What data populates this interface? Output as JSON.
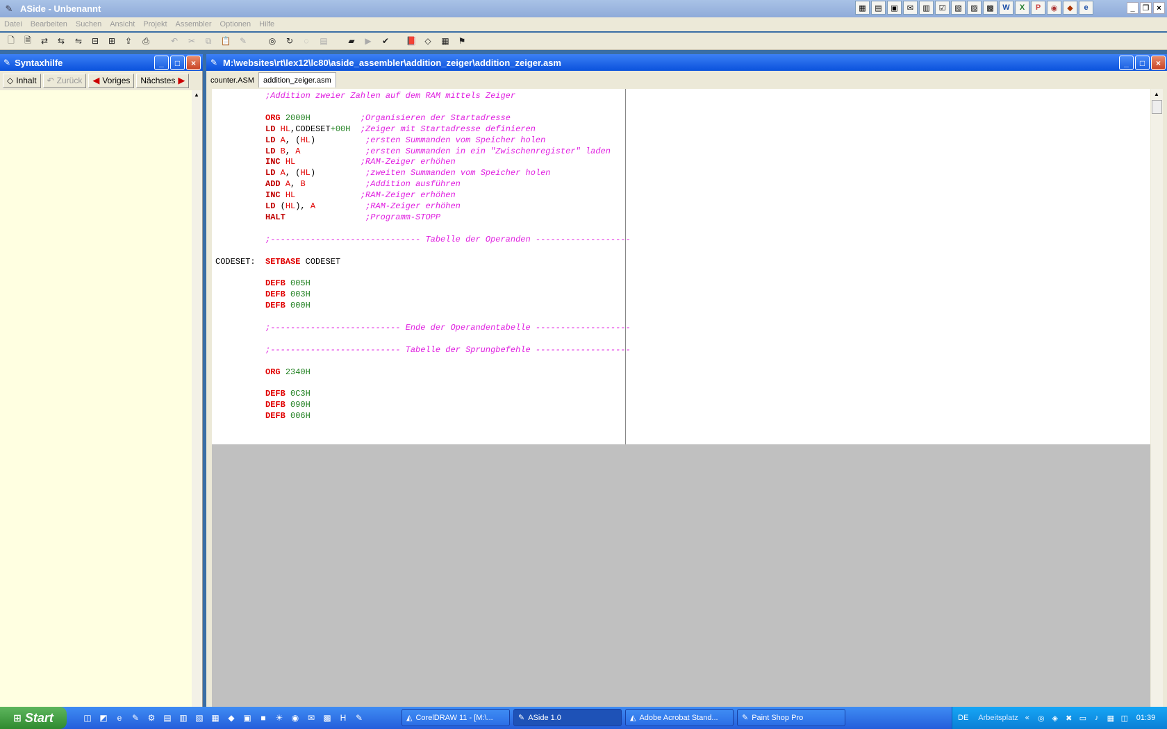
{
  "window": {
    "title": "ASide - Unbenannt"
  },
  "menu": [
    "Datei",
    "Bearbeiten",
    "Suchen",
    "Ansicht",
    "Projekt",
    "Assembler",
    "Optionen",
    "Hilfe"
  ],
  "syntax_panel": {
    "title": "Syntaxhilfe",
    "nav": {
      "contents": "Inhalt",
      "back": "Zurück",
      "prev": "Voriges",
      "next": "Nächstes"
    }
  },
  "editor": {
    "title": "M:\\websites\\rt\\lex12\\lc80\\aside_assembler\\addition_zeiger\\addition_zeiger.asm",
    "tabs": [
      "counter.ASM",
      "addition_zeiger.asm"
    ],
    "active_tab": 1,
    "code": [
      {
        "line": 0,
        "parts": [
          {
            "t": "          "
          },
          {
            "c": "cm",
            "t": ";Addition zweier Zahlen auf dem RAM mittels Zeiger"
          }
        ]
      },
      {
        "line": 2,
        "parts": [
          {
            "t": "          "
          },
          {
            "c": "kwr",
            "t": "ORG"
          },
          {
            "t": " "
          },
          {
            "c": "num",
            "t": "2000H"
          },
          {
            "t": "          "
          },
          {
            "c": "cm",
            "t": ";Organisieren der Startadresse"
          }
        ]
      },
      {
        "line": 3,
        "parts": [
          {
            "t": "          "
          },
          {
            "c": "kw",
            "t": "LD"
          },
          {
            "t": " "
          },
          {
            "c": "reg",
            "t": "HL"
          },
          {
            "t": ",CODESET"
          },
          {
            "c": "num",
            "t": "+00H"
          },
          {
            "t": "  "
          },
          {
            "c": "cm",
            "t": ";Zeiger mit Startadresse definieren"
          }
        ]
      },
      {
        "line": 4,
        "parts": [
          {
            "t": "          "
          },
          {
            "c": "kw",
            "t": "LD"
          },
          {
            "t": " "
          },
          {
            "c": "reg",
            "t": "A"
          },
          {
            "t": ", ("
          },
          {
            "c": "reg",
            "t": "HL"
          },
          {
            "t": ")"
          },
          {
            "t": "          "
          },
          {
            "c": "cm",
            "t": ";ersten Summanden vom Speicher holen"
          }
        ]
      },
      {
        "line": 5,
        "parts": [
          {
            "t": "          "
          },
          {
            "c": "kw",
            "t": "LD"
          },
          {
            "t": " "
          },
          {
            "c": "reg",
            "t": "B"
          },
          {
            "t": ", "
          },
          {
            "c": "reg",
            "t": "A"
          },
          {
            "t": "             "
          },
          {
            "c": "cm",
            "t": ";ersten Summanden in ein \"Zwischenregister\" laden"
          }
        ]
      },
      {
        "line": 6,
        "parts": [
          {
            "t": "          "
          },
          {
            "c": "kw",
            "t": "INC"
          },
          {
            "t": " "
          },
          {
            "c": "reg",
            "t": "HL"
          },
          {
            "t": "             "
          },
          {
            "c": "cm",
            "t": ";RAM-Zeiger erhöhen"
          }
        ]
      },
      {
        "line": 7,
        "parts": [
          {
            "t": "          "
          },
          {
            "c": "kw",
            "t": "LD"
          },
          {
            "t": " "
          },
          {
            "c": "reg",
            "t": "A"
          },
          {
            "t": ", ("
          },
          {
            "c": "reg",
            "t": "HL"
          },
          {
            "t": ")"
          },
          {
            "t": "          "
          },
          {
            "c": "cm",
            "t": ";zweiten Summanden vom Speicher holen"
          }
        ]
      },
      {
        "line": 8,
        "parts": [
          {
            "t": "          "
          },
          {
            "c": "kw",
            "t": "ADD"
          },
          {
            "t": " "
          },
          {
            "c": "reg",
            "t": "A"
          },
          {
            "t": ", "
          },
          {
            "c": "reg",
            "t": "B"
          },
          {
            "t": "            "
          },
          {
            "c": "cm",
            "t": ";Addition ausführen"
          }
        ]
      },
      {
        "line": 9,
        "parts": [
          {
            "t": "          "
          },
          {
            "c": "kw",
            "t": "INC"
          },
          {
            "t": " "
          },
          {
            "c": "reg",
            "t": "HL"
          },
          {
            "t": "             "
          },
          {
            "c": "cm",
            "t": ";RAM-Zeiger erhöhen"
          }
        ]
      },
      {
        "line": 10,
        "parts": [
          {
            "t": "          "
          },
          {
            "c": "kw",
            "t": "LD"
          },
          {
            "t": " ("
          },
          {
            "c": "reg",
            "t": "HL"
          },
          {
            "t": "), "
          },
          {
            "c": "reg",
            "t": "A"
          },
          {
            "t": "          "
          },
          {
            "c": "cm",
            "t": ";RAM-Zeiger erhöhen"
          }
        ]
      },
      {
        "line": 11,
        "parts": [
          {
            "t": "          "
          },
          {
            "c": "kw",
            "t": "HALT"
          },
          {
            "t": "                "
          },
          {
            "c": "cm",
            "t": ";Programm-STOPP"
          }
        ]
      },
      {
        "line": 13,
        "parts": [
          {
            "t": "          "
          },
          {
            "c": "cm",
            "t": ";------------------------------ Tabelle der Operanden -------------------"
          }
        ]
      },
      {
        "line": 15,
        "parts": [
          {
            "t": "CODESET:  "
          },
          {
            "c": "kwr",
            "t": "SETBASE"
          },
          {
            "t": " CODESET"
          }
        ]
      },
      {
        "line": 17,
        "parts": [
          {
            "t": "          "
          },
          {
            "c": "kwr",
            "t": "DEFB"
          },
          {
            "t": " "
          },
          {
            "c": "num",
            "t": "005H"
          }
        ]
      },
      {
        "line": 18,
        "parts": [
          {
            "t": "          "
          },
          {
            "c": "kwr",
            "t": "DEFB"
          },
          {
            "t": " "
          },
          {
            "c": "num",
            "t": "003H"
          }
        ]
      },
      {
        "line": 19,
        "parts": [
          {
            "t": "          "
          },
          {
            "c": "kwr",
            "t": "DEFB"
          },
          {
            "t": " "
          },
          {
            "c": "num",
            "t": "000H"
          }
        ]
      },
      {
        "line": 21,
        "parts": [
          {
            "t": "          "
          },
          {
            "c": "cm",
            "t": ";-------------------------- Ende der Operandentabelle -------------------"
          }
        ]
      },
      {
        "line": 23,
        "parts": [
          {
            "t": "          "
          },
          {
            "c": "cm",
            "t": ";-------------------------- Tabelle der Sprungbefehle -------------------"
          }
        ]
      },
      {
        "line": 25,
        "parts": [
          {
            "t": "          "
          },
          {
            "c": "kwr",
            "t": "ORG"
          },
          {
            "t": " "
          },
          {
            "c": "num",
            "t": "2340H"
          }
        ]
      },
      {
        "line": 27,
        "parts": [
          {
            "t": "          "
          },
          {
            "c": "kwr",
            "t": "DEFB"
          },
          {
            "t": " "
          },
          {
            "c": "num",
            "t": "0C3H"
          }
        ]
      },
      {
        "line": 28,
        "parts": [
          {
            "t": "          "
          },
          {
            "c": "kwr",
            "t": "DEFB"
          },
          {
            "t": " "
          },
          {
            "c": "num",
            "t": "090H"
          }
        ]
      },
      {
        "line": 29,
        "parts": [
          {
            "t": "          "
          },
          {
            "c": "kwr",
            "t": "DEFB"
          },
          {
            "t": " "
          },
          {
            "c": "num",
            "t": "006H"
          }
        ]
      }
    ]
  },
  "taskbar": {
    "start": "Start",
    "tasks": [
      "CorelDRAW 11 - [M:\\...",
      "ASide 1.0",
      "Adobe Acrobat Stand...",
      "Paint Shop Pro"
    ],
    "active_task": 1,
    "lang": "DE",
    "desktop_label": "Arbeitsplatz",
    "clock": "01:39"
  },
  "colors": {
    "titlebar_active": "#0a52dc",
    "editor_bg": "#ffffff",
    "panel_bg": "#ffffe1",
    "comment": "#e020e0",
    "keyword": "#c00000",
    "number": "#208020"
  }
}
